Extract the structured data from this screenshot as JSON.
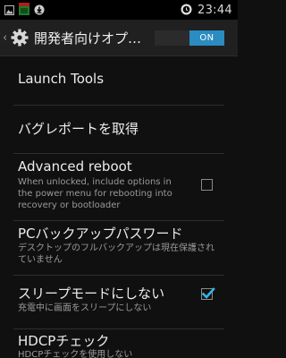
{
  "status_bar": {
    "time": "23:44",
    "icons": [
      "image-icon",
      "sd-card-icon",
      "download-icon",
      "timer-icon"
    ]
  },
  "action_bar": {
    "title": "開発者向けオプ…",
    "toggle_label": "ON",
    "toggle_state": "on"
  },
  "settings": [
    {
      "title": "Launch Tools"
    },
    {
      "title": "バグレポートを取得"
    },
    {
      "title": "Advanced reboot",
      "summary": "When unlocked, include options in the power menu for rebooting into recovery or bootloader",
      "checked": false
    },
    {
      "title": "PCバックアップパスワード",
      "summary": "デスクトップのフルバックアップは現在保護されていません"
    },
    {
      "title": "スリープモードにしない",
      "summary": "充電中に画面をスリープにしない",
      "checked": true
    },
    {
      "title": "HDCPチェック",
      "summary": "HDCPチェックを使用しない"
    }
  ],
  "colors": {
    "accent": "#2a8cc0",
    "checkmark": "#33b5e5",
    "background": "#101010"
  }
}
